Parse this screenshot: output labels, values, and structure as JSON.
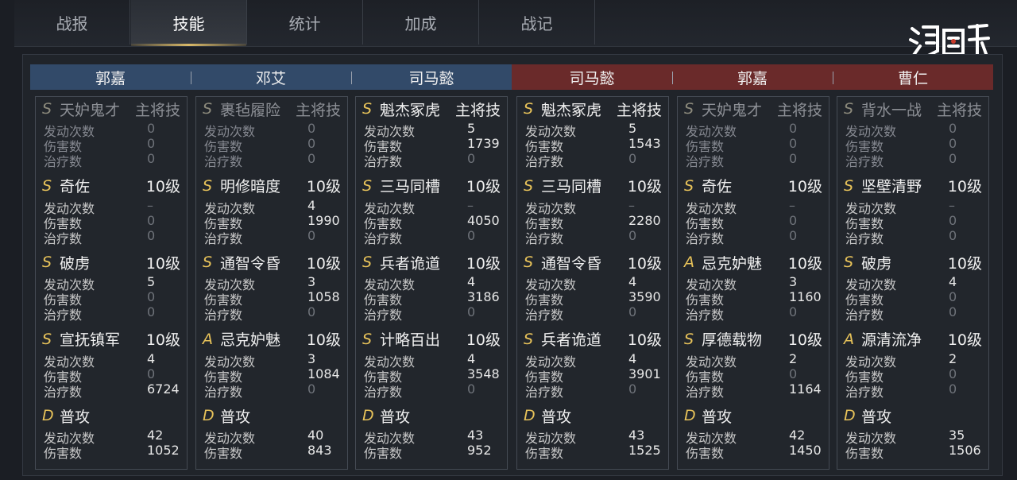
{
  "tabs": [
    {
      "label": "战报",
      "active": false
    },
    {
      "label": "技能",
      "active": true
    },
    {
      "label": "统计",
      "active": false
    },
    {
      "label": "加成",
      "active": false
    },
    {
      "label": "战记",
      "active": false
    }
  ],
  "logo_text": "鸿图之下",
  "teams": {
    "blue": [
      "郭嘉",
      "邓艾",
      "司马懿"
    ],
    "red": [
      "司马懿",
      "郭嘉",
      "曹仁"
    ]
  },
  "colors": {
    "grade_gold": "#e8c35a",
    "blue_header": "#324a69",
    "red_header": "#6a2a2a"
  },
  "stat_labels": {
    "trigger": "发动次数",
    "damage": "伤害数",
    "heal": "治疗数"
  },
  "columns": [
    {
      "skills": [
        {
          "grade": "S",
          "name": "天妒鬼才",
          "level": "主将技",
          "dim": true,
          "stats": [
            [
              "发动次数",
              "0"
            ],
            [
              "伤害数",
              "0"
            ],
            [
              "治疗数",
              "0"
            ]
          ]
        },
        {
          "grade": "S",
          "name": "奇佐",
          "level": "10级",
          "dim": false,
          "stats": [
            [
              "发动次数",
              "–"
            ],
            [
              "伤害数",
              "0"
            ],
            [
              "治疗数",
              "0"
            ]
          ]
        },
        {
          "grade": "S",
          "name": "破虏",
          "level": "10级",
          "dim": false,
          "stats": [
            [
              "发动次数",
              "5"
            ],
            [
              "伤害数",
              "0"
            ],
            [
              "治疗数",
              "0"
            ]
          ]
        },
        {
          "grade": "S",
          "name": "宣抚镇军",
          "level": "10级",
          "dim": false,
          "stats": [
            [
              "发动次数",
              "4"
            ],
            [
              "伤害数",
              "0"
            ],
            [
              "治疗数",
              "6724"
            ]
          ]
        },
        {
          "grade": "D",
          "name": "普攻",
          "level": "",
          "dim": false,
          "stats": [
            [
              "发动次数",
              "42"
            ],
            [
              "伤害数",
              "1052"
            ]
          ]
        }
      ]
    },
    {
      "skills": [
        {
          "grade": "S",
          "name": "裹毡履险",
          "level": "主将技",
          "dim": true,
          "stats": [
            [
              "发动次数",
              "0"
            ],
            [
              "伤害数",
              "0"
            ],
            [
              "治疗数",
              "0"
            ]
          ]
        },
        {
          "grade": "S",
          "name": "明修暗度",
          "level": "10级",
          "dim": false,
          "stats": [
            [
              "发动次数",
              "4"
            ],
            [
              "伤害数",
              "1990"
            ],
            [
              "治疗数",
              "0"
            ]
          ]
        },
        {
          "grade": "S",
          "name": "通智令昏",
          "level": "10级",
          "dim": false,
          "stats": [
            [
              "发动次数",
              "3"
            ],
            [
              "伤害数",
              "1058"
            ],
            [
              "治疗数",
              "0"
            ]
          ]
        },
        {
          "grade": "A",
          "name": "忌克妒魅",
          "level": "10级",
          "dim": false,
          "stats": [
            [
              "发动次数",
              "3"
            ],
            [
              "伤害数",
              "1084"
            ],
            [
              "治疗数",
              "0"
            ]
          ]
        },
        {
          "grade": "D",
          "name": "普攻",
          "level": "",
          "dim": false,
          "stats": [
            [
              "发动次数",
              "40"
            ],
            [
              "伤害数",
              "843"
            ]
          ]
        }
      ]
    },
    {
      "skills": [
        {
          "grade": "S",
          "name": "魁杰冢虎",
          "level": "主将技",
          "dim": false,
          "stats": [
            [
              "发动次数",
              "5"
            ],
            [
              "伤害数",
              "1739"
            ],
            [
              "治疗数",
              "0"
            ]
          ]
        },
        {
          "grade": "S",
          "name": "三马同槽",
          "level": "10级",
          "dim": false,
          "stats": [
            [
              "发动次数",
              "–"
            ],
            [
              "伤害数",
              "4050"
            ],
            [
              "治疗数",
              "0"
            ]
          ]
        },
        {
          "grade": "S",
          "name": "兵者诡道",
          "level": "10级",
          "dim": false,
          "stats": [
            [
              "发动次数",
              "4"
            ],
            [
              "伤害数",
              "3186"
            ],
            [
              "治疗数",
              "0"
            ]
          ]
        },
        {
          "grade": "S",
          "name": "计略百出",
          "level": "10级",
          "dim": false,
          "stats": [
            [
              "发动次数",
              "4"
            ],
            [
              "伤害数",
              "3548"
            ],
            [
              "治疗数",
              "0"
            ]
          ]
        },
        {
          "grade": "D",
          "name": "普攻",
          "level": "",
          "dim": false,
          "stats": [
            [
              "发动次数",
              "43"
            ],
            [
              "伤害数",
              "952"
            ]
          ]
        }
      ]
    },
    {
      "skills": [
        {
          "grade": "S",
          "name": "魁杰冢虎",
          "level": "主将技",
          "dim": false,
          "stats": [
            [
              "发动次数",
              "5"
            ],
            [
              "伤害数",
              "1543"
            ],
            [
              "治疗数",
              "0"
            ]
          ]
        },
        {
          "grade": "S",
          "name": "三马同槽",
          "level": "10级",
          "dim": false,
          "stats": [
            [
              "发动次数",
              "–"
            ],
            [
              "伤害数",
              "2280"
            ],
            [
              "治疗数",
              "0"
            ]
          ]
        },
        {
          "grade": "S",
          "name": "通智令昏",
          "level": "10级",
          "dim": false,
          "stats": [
            [
              "发动次数",
              "4"
            ],
            [
              "伤害数",
              "3590"
            ],
            [
              "治疗数",
              "0"
            ]
          ]
        },
        {
          "grade": "S",
          "name": "兵者诡道",
          "level": "10级",
          "dim": false,
          "stats": [
            [
              "发动次数",
              "4"
            ],
            [
              "伤害数",
              "3901"
            ],
            [
              "治疗数",
              "0"
            ]
          ]
        },
        {
          "grade": "D",
          "name": "普攻",
          "level": "",
          "dim": false,
          "stats": [
            [
              "发动次数",
              "43"
            ],
            [
              "伤害数",
              "1525"
            ]
          ]
        }
      ]
    },
    {
      "skills": [
        {
          "grade": "S",
          "name": "天妒鬼才",
          "level": "主将技",
          "dim": true,
          "stats": [
            [
              "发动次数",
              "0"
            ],
            [
              "伤害数",
              "0"
            ],
            [
              "治疗数",
              "0"
            ]
          ]
        },
        {
          "grade": "S",
          "name": "奇佐",
          "level": "10级",
          "dim": false,
          "stats": [
            [
              "发动次数",
              "–"
            ],
            [
              "伤害数",
              "0"
            ],
            [
              "治疗数",
              "0"
            ]
          ]
        },
        {
          "grade": "A",
          "name": "忌克妒魅",
          "level": "10级",
          "dim": false,
          "stats": [
            [
              "发动次数",
              "3"
            ],
            [
              "伤害数",
              "1160"
            ],
            [
              "治疗数",
              "0"
            ]
          ]
        },
        {
          "grade": "S",
          "name": "厚德载物",
          "level": "10级",
          "dim": false,
          "stats": [
            [
              "发动次数",
              "2"
            ],
            [
              "伤害数",
              "0"
            ],
            [
              "治疗数",
              "1164"
            ]
          ]
        },
        {
          "grade": "D",
          "name": "普攻",
          "level": "",
          "dim": false,
          "stats": [
            [
              "发动次数",
              "42"
            ],
            [
              "伤害数",
              "1450"
            ]
          ]
        }
      ]
    },
    {
      "skills": [
        {
          "grade": "S",
          "name": "背水一战",
          "level": "主将技",
          "dim": true,
          "stats": [
            [
              "发动次数",
              "0"
            ],
            [
              "伤害数",
              "0"
            ],
            [
              "治疗数",
              "0"
            ]
          ]
        },
        {
          "grade": "S",
          "name": "坚壁清野",
          "level": "10级",
          "dim": false,
          "stats": [
            [
              "发动次数",
              "–"
            ],
            [
              "伤害数",
              "0"
            ],
            [
              "治疗数",
              "0"
            ]
          ]
        },
        {
          "grade": "S",
          "name": "破虏",
          "level": "10级",
          "dim": false,
          "stats": [
            [
              "发动次数",
              "4"
            ],
            [
              "伤害数",
              "0"
            ],
            [
              "治疗数",
              "0"
            ]
          ]
        },
        {
          "grade": "A",
          "name": "源清流净",
          "level": "10级",
          "dim": false,
          "stats": [
            [
              "发动次数",
              "2"
            ],
            [
              "伤害数",
              "0"
            ],
            [
              "治疗数",
              "0"
            ]
          ]
        },
        {
          "grade": "D",
          "name": "普攻",
          "level": "",
          "dim": false,
          "stats": [
            [
              "发动次数",
              "35"
            ],
            [
              "伤害数",
              "1506"
            ]
          ]
        }
      ]
    }
  ]
}
